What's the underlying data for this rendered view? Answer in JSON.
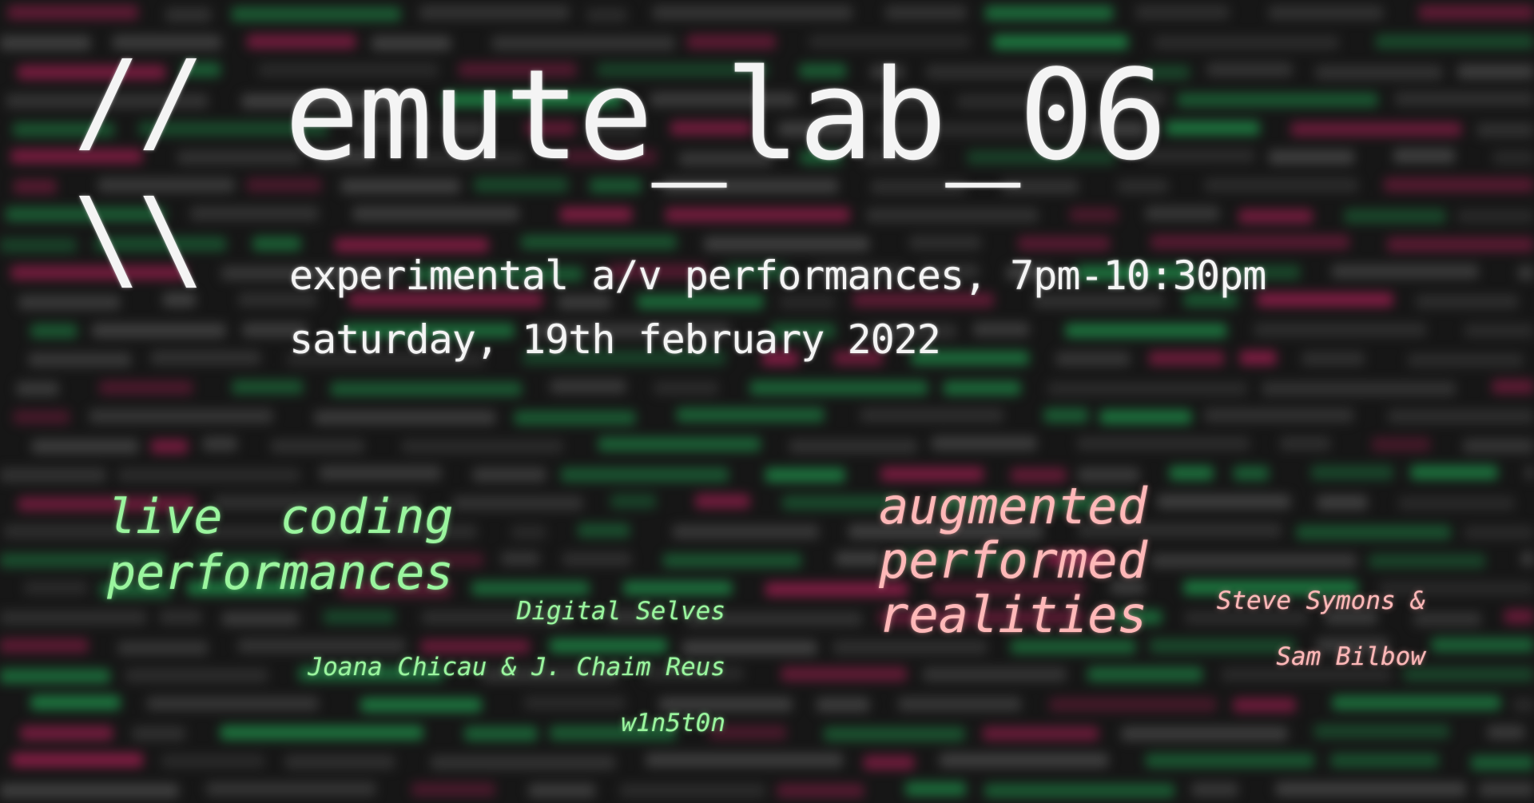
{
  "poster": {
    "slashes_top": "//",
    "slashes_bottom": "\\\\",
    "title": "emute_lab_06",
    "subtitle": "experimental a/v performances, 7pm-10:30pm",
    "date": "saturday, 19th february 2022"
  },
  "sections": {
    "live_coding": {
      "heading_line1": "live  coding",
      "heading_line2": "performances",
      "performers": [
        "Digital Selves",
        "Joana Chicau & J. Chaim Reus",
        "w1n5t0n"
      ]
    },
    "augmented": {
      "heading_line1": "augmented",
      "heading_line2": "performed",
      "heading_line3": "realities",
      "performers": [
        "Steve Symons &",
        "Sam Bilbow"
      ]
    }
  },
  "colors": {
    "background": "#161616",
    "title_text": "#f4f4f4",
    "live_coding_accent": "#9af59e",
    "augmented_accent": "#ffb8b8",
    "code_green": "#1f8f4a",
    "code_magenta": "#9a1f4e",
    "code_gray": "#4a4a4a"
  }
}
